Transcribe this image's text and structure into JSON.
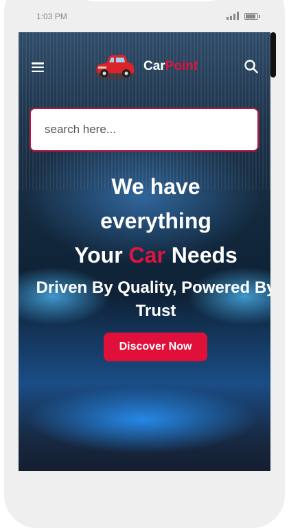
{
  "status_bar": {
    "time": "1:03 PM"
  },
  "header": {
    "brand_part1": "Car",
    "brand_part2": "Point"
  },
  "search": {
    "placeholder": "search here..."
  },
  "hero": {
    "line1": "We have",
    "line2": "everything",
    "line3_pre": "Your ",
    "line3_highlight": "Car",
    "line3_post": " Needs",
    "tagline": "Driven By Quality, Powered By Trust",
    "cta_label": "Discover Now"
  },
  "colors": {
    "accent": "#e2133f",
    "search_border": "#b8163f",
    "cta_background": "#df1039"
  },
  "icons": [
    "hamburger-menu-icon",
    "car-logo",
    "search-icon",
    "signal-icon",
    "battery-icon"
  ]
}
